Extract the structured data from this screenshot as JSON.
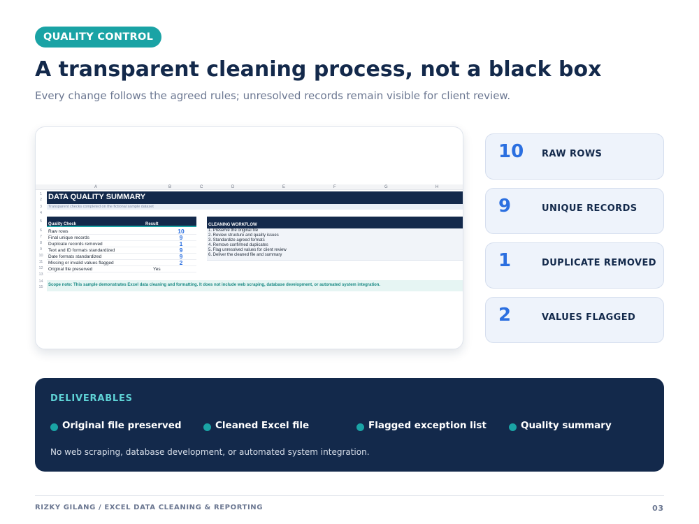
{
  "header": {
    "eyebrow": "QUALITY CONTROL",
    "title": "A transparent cleaning process, not a black box",
    "subtitle": "Every change follows the agreed rules; unresolved records remain visible for client review."
  },
  "spreadsheet": {
    "columns": [
      "A",
      "B",
      "C",
      "D",
      "E",
      "F",
      "G",
      "H"
    ],
    "row_numbers": [
      "1",
      "2",
      "3",
      "4",
      "5",
      "6",
      "7",
      "8",
      "9",
      "10",
      "11",
      "12",
      "13",
      "14",
      "15"
    ],
    "title": "DATA QUALITY SUMMARY",
    "tagline": "Transparent checks completed on the fictional sample dataset",
    "quality_header": "Quality Check",
    "result_header": "Result",
    "checks": [
      {
        "label": "Raw rows",
        "value": "10"
      },
      {
        "label": "Final unique records",
        "value": "9"
      },
      {
        "label": "Duplicate records removed",
        "value": "1"
      },
      {
        "label": "Text and ID formats standardized",
        "value": "9"
      },
      {
        "label": "Date formats standardized",
        "value": "9"
      },
      {
        "label": "Missing or invalid values flagged",
        "value": "2"
      },
      {
        "label": "Original file preserved",
        "value": "Yes"
      }
    ],
    "workflow_header": "CLEANING WORKFLOW",
    "workflow": [
      "1. Preserve the original file",
      "2. Review structure and quality issues",
      "3. Standardize agreed formats",
      "4. Remove confirmed duplicates",
      "5. Flag unresolved values for client review",
      "6. Deliver the cleaned file and summary"
    ],
    "scope_note": "Scope note: This sample demonstrates Excel data cleaning and formatting. It does not include web scraping, database development, or automated system integration."
  },
  "stats": [
    {
      "value": "10",
      "label": "RAW ROWS"
    },
    {
      "value": "9",
      "label": "UNIQUE RECORDS"
    },
    {
      "value": "1",
      "label": "DUPLICATE REMOVED"
    },
    {
      "value": "2",
      "label": "VALUES FLAGGED"
    }
  ],
  "deliverables": {
    "heading": "DELIVERABLES",
    "items": [
      "Original file preserved",
      "Cleaned Excel file",
      "Flagged exception list",
      "Quality summary"
    ],
    "note": "No web scraping, database development, or automated system integration."
  },
  "footer": {
    "credit": "RIZKY GILANG  /  EXCEL DATA CLEANING & REPORTING",
    "page": "03"
  }
}
